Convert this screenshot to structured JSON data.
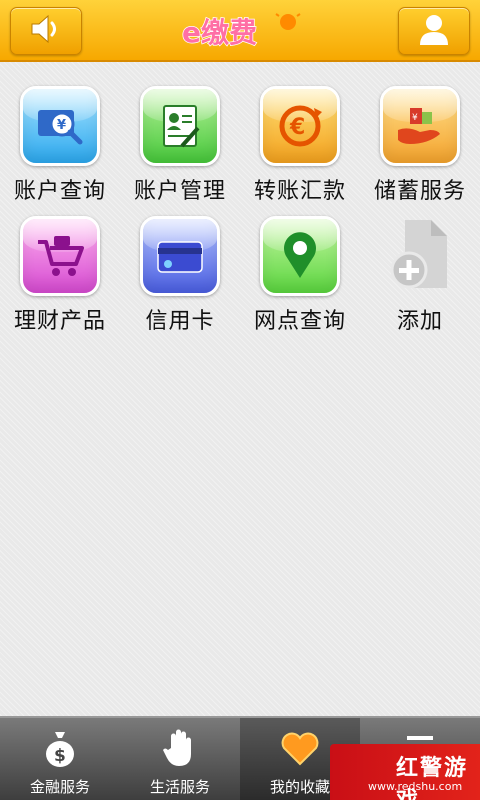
{
  "header": {
    "left_button_icon": "speaker-icon",
    "logo_text": "e缴费",
    "right_button_icon": "user-icon"
  },
  "grid": {
    "items": [
      {
        "label": "账户查询",
        "icon": "account-query-icon",
        "color": "#2ba8ee"
      },
      {
        "label": "账户管理",
        "icon": "account-manage-icon",
        "color": "#46c83a"
      },
      {
        "label": "转账汇款",
        "icon": "euro-transfer-icon",
        "color": "#f3a11d"
      },
      {
        "label": "储蓄服务",
        "icon": "savings-hand-icon",
        "color": "#f4a32c"
      },
      {
        "label": "理财产品",
        "icon": "shopping-cart-icon",
        "color": "#d64ad1"
      },
      {
        "label": "信用卡",
        "icon": "credit-card-icon",
        "color": "#4a5ee2"
      },
      {
        "label": "网点查询",
        "icon": "map-pin-icon",
        "color": "#5ad53e"
      },
      {
        "label": "添加",
        "icon": "add-file-icon",
        "color": "#bfbfbf"
      }
    ]
  },
  "tabbar": {
    "tabs": [
      {
        "label": "金融服务",
        "icon": "money-bag-icon"
      },
      {
        "label": "生活服务",
        "icon": "hand-icon"
      },
      {
        "label": "我的收藏",
        "icon": "heart-icon",
        "active": true
      },
      {
        "label": "",
        "icon": "more-icon"
      }
    ]
  },
  "watermark": {
    "text": "红警游戏",
    "url": "www.redshu.com"
  }
}
